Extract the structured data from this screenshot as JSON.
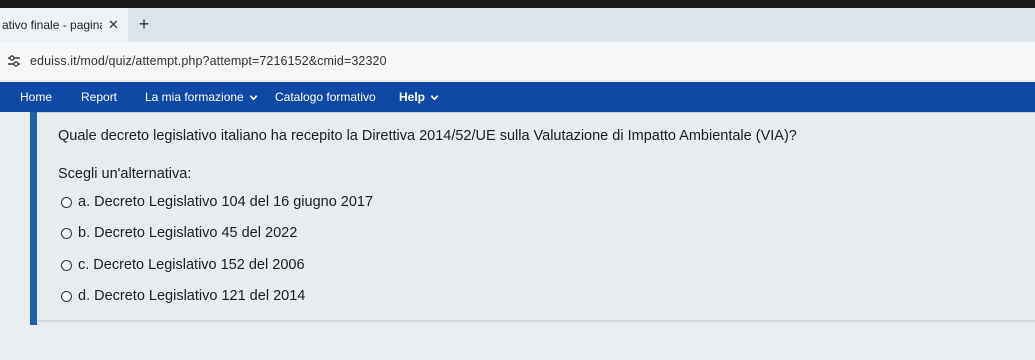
{
  "browser": {
    "tab_title": "ativo finale - pagina",
    "tab_close": "✕",
    "new_tab": "+",
    "url": "eduiss.it/mod/quiz/attempt.php?attempt=7216152&cmid=32320"
  },
  "navbar": {
    "items": [
      {
        "label": "Home"
      },
      {
        "label": "Report"
      },
      {
        "label": "La mia formazione"
      },
      {
        "label": "Catalogo formativo"
      },
      {
        "label": "Help"
      }
    ]
  },
  "question": {
    "text": "Quale decreto legislativo italiano ha recepito la Direttiva 2014/52/UE sulla Valutazione di Impatto Ambientale (VIA)?",
    "prompt": "Scegli un'alternativa:",
    "options": [
      {
        "label": "a. Decreto Legislativo 104 del 16 giugno 2017"
      },
      {
        "label": "b. Decreto Legislativo 45 del 2022"
      },
      {
        "label": "c. Decreto Legislativo 152 del 2006"
      },
      {
        "label": "d. Decreto Legislativo 121 del 2014"
      }
    ]
  },
  "colors": {
    "navbar": "#0e4aa5",
    "accent_bar": "#1e5fa8"
  }
}
